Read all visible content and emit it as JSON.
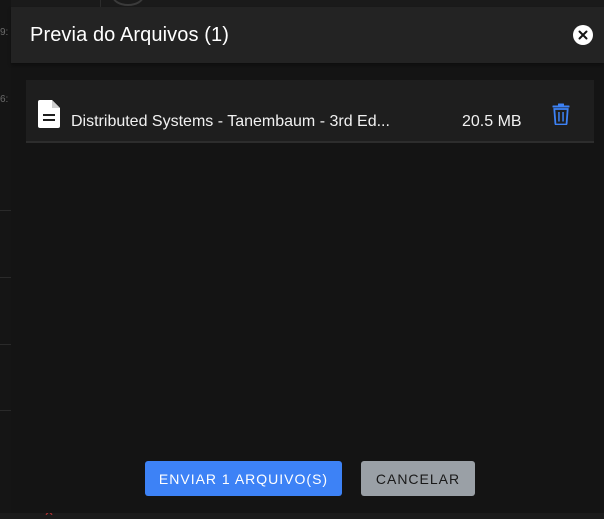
{
  "background": {
    "time_labels": [
      "9:",
      "6:"
    ]
  },
  "modal": {
    "title": "Previa do Arquivos (1)",
    "close_icon": "close-circle-icon",
    "files": [
      {
        "icon": "file-document-icon",
        "name": "Distributed Systems - Tanembaum - 3rd Ed...",
        "size": "20.5 MB",
        "delete_icon": "trash-icon"
      }
    ],
    "actions": {
      "send_label": "ENVIAR 1 ARQUIVO(S)",
      "cancel_label": "CANCELAR"
    }
  },
  "colors": {
    "accent": "#3d82f6",
    "header_bg": "#232323",
    "modal_bg": "#141414",
    "cancel_bg": "#9aa0a6"
  }
}
